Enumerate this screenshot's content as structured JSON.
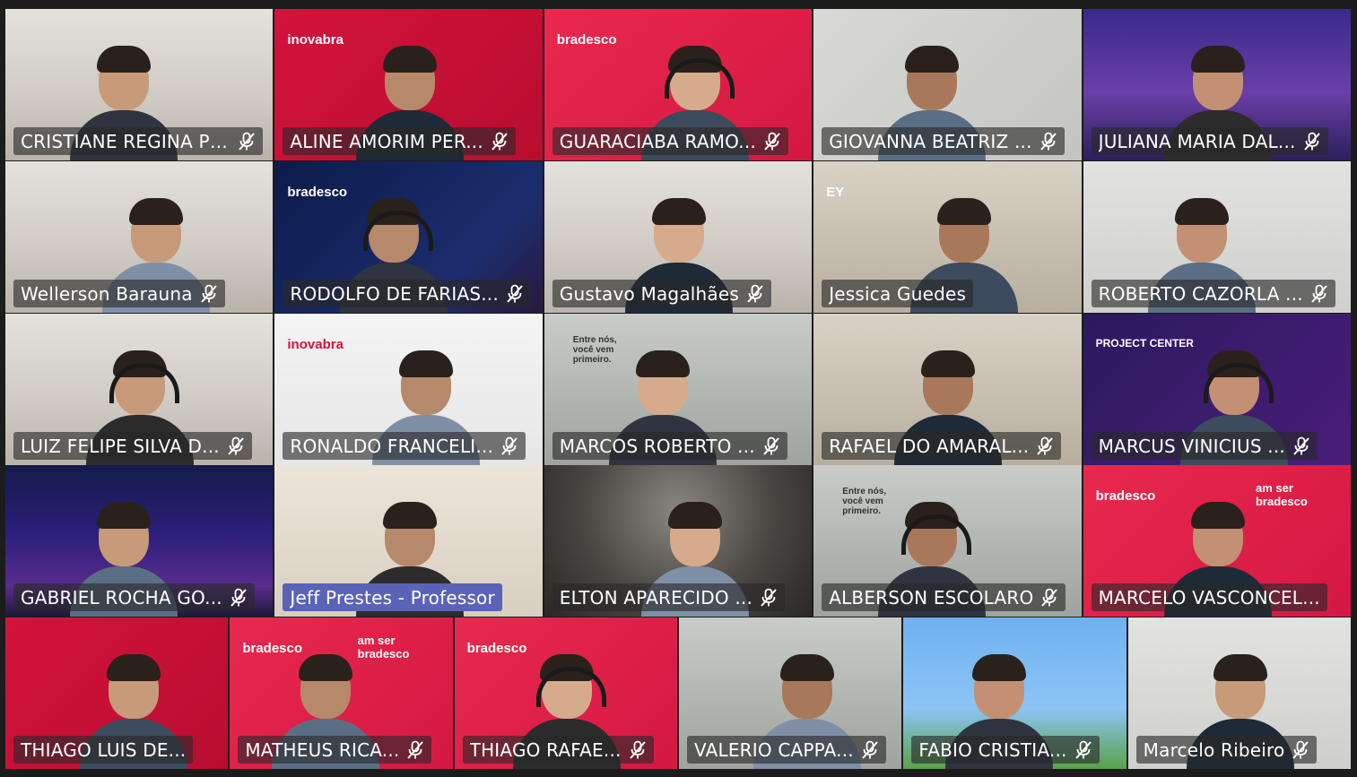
{
  "meeting": {
    "rows": [
      [
        {
          "name": "CRISTIANE REGINA PER...",
          "muted": true,
          "host": false,
          "bg": "room"
        },
        {
          "name": "ALINE AMORIM PER...",
          "muted": true,
          "host": false,
          "bg": "red",
          "logo": "inovabra"
        },
        {
          "name": "GUARACIABA RAMO...",
          "muted": true,
          "host": false,
          "bg": "pink",
          "logo": "bradesco"
        },
        {
          "name": "GIOVANNA BEATRIZ ...",
          "muted": true,
          "host": false,
          "bg": "wall"
        },
        {
          "name": "JULIANA MARIA DAL...",
          "muted": true,
          "host": false,
          "bg": "mountain"
        }
      ],
      [
        {
          "name": "Wellerson Barauna",
          "muted": true,
          "host": false,
          "bg": "room"
        },
        {
          "name": "RODOLFO DE FARIAS...",
          "muted": true,
          "host": false,
          "bg": "navy",
          "logo": "bradesco"
        },
        {
          "name": "Gustavo Magalhães",
          "muted": true,
          "host": false,
          "bg": "room"
        },
        {
          "name": "Jessica Guedes",
          "muted": false,
          "host": false,
          "bg": "office",
          "logo": "EY"
        },
        {
          "name": "ROBERTO CAZORLA ...",
          "muted": true,
          "host": false,
          "bg": "plain"
        }
      ],
      [
        {
          "name": "LUIZ FELIPE SILVA D...",
          "muted": true,
          "host": false,
          "bg": "room"
        },
        {
          "name": "RONALDO FRANCELI...",
          "muted": true,
          "host": false,
          "bg": "white",
          "logo": "inovabra"
        },
        {
          "name": "MARCOS ROBERTO ...",
          "muted": true,
          "host": false,
          "bg": "building",
          "slogan": "Entre nós, você vem primeiro."
        },
        {
          "name": "RAFAEL DO AMARAL...",
          "muted": true,
          "host": false,
          "bg": "office"
        },
        {
          "name": "MARCUS VINICIUS ...",
          "muted": true,
          "host": false,
          "bg": "purple",
          "logo": "PROJECT CENTER"
        }
      ],
      [
        {
          "name": "GABRIEL ROCHA GO...",
          "muted": true,
          "host": false,
          "bg": "aurora"
        },
        {
          "name": "Jeff Prestes - Professor",
          "muted": false,
          "host": true,
          "bg": "shelf"
        },
        {
          "name": "ELTON APARECIDO ...",
          "muted": true,
          "host": false,
          "bg": "dark"
        },
        {
          "name": "ALBERSON ESCOLARO",
          "muted": true,
          "host": false,
          "bg": "building",
          "slogan": "Entre nós, você vem primeiro."
        },
        {
          "name": "MARCELO VASCONCEL...",
          "muted": false,
          "host": false,
          "bg": "pink",
          "logo": "bradesco",
          "badge": "am ser bradesco"
        }
      ],
      [
        {
          "name": "THIAGO LUIS DE...",
          "muted": false,
          "host": false,
          "bg": "red"
        },
        {
          "name": "MATHEUS RICA...",
          "muted": true,
          "host": false,
          "bg": "pink",
          "logo": "bradesco",
          "badge": "am ser bradesco"
        },
        {
          "name": "THIAGO RAFAE...",
          "muted": true,
          "host": false,
          "bg": "pink",
          "logo": "bradesco"
        },
        {
          "name": "VALERIO CAPPA...",
          "muted": true,
          "host": false,
          "bg": "building"
        },
        {
          "name": "FABIO CRISTIA...",
          "muted": true,
          "host": false,
          "bg": "game"
        },
        {
          "name": "Marcelo Ribeiro",
          "muted": true,
          "host": false,
          "bg": "plain"
        }
      ]
    ]
  },
  "colors": {
    "frame": "#1c1c1c",
    "nameplate": "#2a2a2a",
    "host_nameplate": "#5b63b8",
    "bradesco_red": "#cc1236"
  }
}
